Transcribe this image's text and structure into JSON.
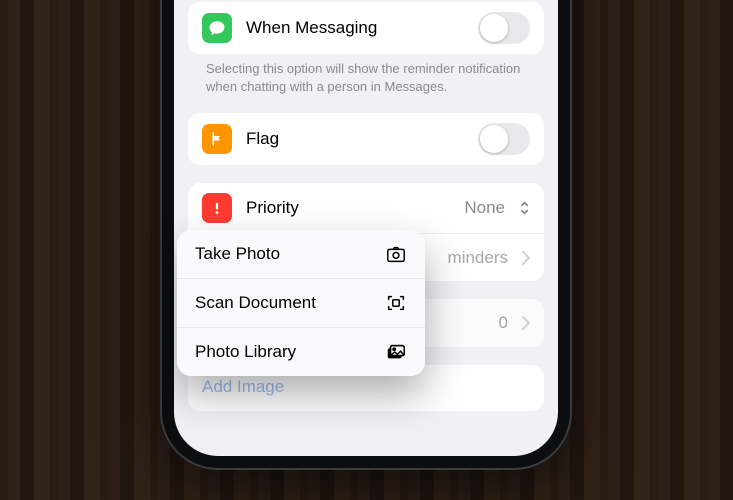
{
  "messaging": {
    "label": "When Messaging",
    "toggle": false,
    "footer": "Selecting this option will show the reminder notification when chatting with a person in Messages."
  },
  "flag": {
    "label": "Flag",
    "toggle": false
  },
  "priority": {
    "label": "Priority",
    "value": "None"
  },
  "list_row": {
    "value_suffix": "minders"
  },
  "subtasks": {
    "value": "0"
  },
  "add_image": {
    "label": "Add Image"
  },
  "popup": {
    "items": [
      {
        "label": "Take Photo"
      },
      {
        "label": "Scan Document"
      },
      {
        "label": "Photo Library"
      }
    ]
  }
}
